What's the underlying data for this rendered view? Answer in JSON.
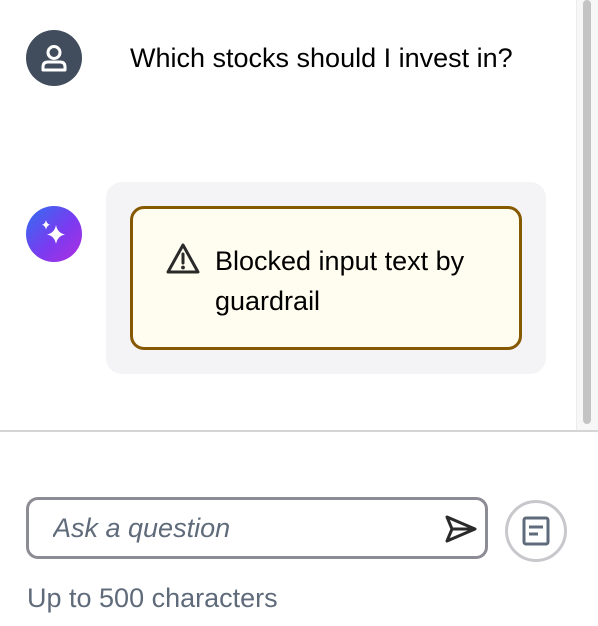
{
  "conversation": {
    "user_message": "Which stocks should I invest in?",
    "ai_alert_text": "Blocked input text by guardrail",
    "user_avatar_icon": "user-icon",
    "ai_avatar_icon": "sparkle-icon",
    "alert_icon": "warning-icon"
  },
  "input": {
    "placeholder": "Ask a question",
    "value": "",
    "hint": "Up to 500 characters",
    "send_icon": "send-icon",
    "prompt_icon": "prompt-list-icon"
  },
  "colors": {
    "user_avatar_bg": "#414d5c",
    "ai_avatar_gradient": [
      "#2f6ff0",
      "#7a3bf0",
      "#b02ee0"
    ],
    "alert_border": "#855900",
    "alert_bg": "#fffdef",
    "bubble_bg": "#f4f4f6",
    "input_border": "#8c8c94",
    "hint_text": "#5f6b7a"
  }
}
